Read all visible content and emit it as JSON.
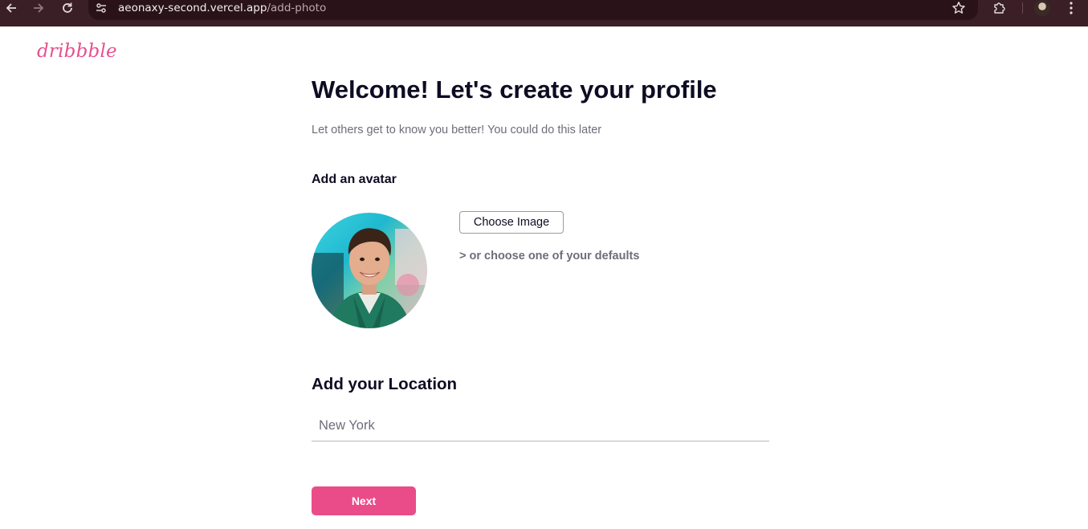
{
  "browser": {
    "url_host": "aeonaxy-second.vercel.app",
    "url_path": "/add-photo"
  },
  "brand": {
    "logo_text": "dribbble",
    "color": "#ea4c89"
  },
  "header": {
    "title": "Welcome! Let's create your profile",
    "subtitle": "Let others get to know you better! You could do this later"
  },
  "avatar_section": {
    "heading": "Add an avatar",
    "choose_image_label": "Choose Image",
    "defaults_link": "> or choose one of your defaults"
  },
  "location_section": {
    "heading": "Add your Location",
    "value": "New York"
  },
  "actions": {
    "next_label": "Next"
  },
  "icons": {
    "back": "arrow-left-icon",
    "forward": "arrow-right-icon",
    "reload": "reload-icon",
    "site_info": "site-settings-icon",
    "bookmark": "star-icon",
    "extensions": "puzzle-icon",
    "menu": "kebab-menu-icon"
  }
}
